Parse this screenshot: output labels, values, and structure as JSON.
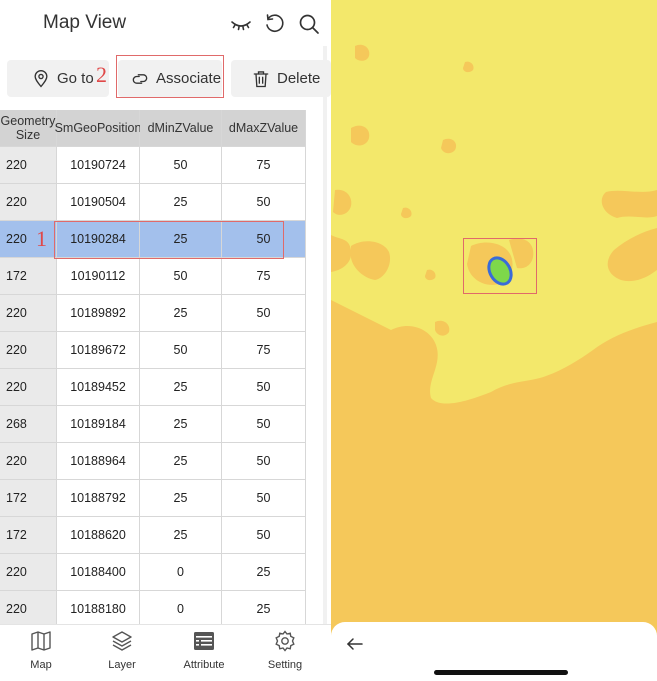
{
  "header": {
    "title": "Map View"
  },
  "toolbar": {
    "goto_label": "Go to",
    "associate_label": "Associate",
    "delete_label": "Delete"
  },
  "annotations": {
    "step1": "1",
    "step2": "2"
  },
  "table": {
    "headers": [
      "Geometry Size",
      "SmGeoPosition",
      "dMinZValue",
      "dMaxZValue"
    ],
    "rows": [
      [
        "220",
        "10190724",
        "50",
        "75"
      ],
      [
        "220",
        "10190504",
        "25",
        "50"
      ],
      [
        "220",
        "10190284",
        "25",
        "50"
      ],
      [
        "172",
        "10190112",
        "50",
        "75"
      ],
      [
        "220",
        "10189892",
        "25",
        "50"
      ],
      [
        "220",
        "10189672",
        "50",
        "75"
      ],
      [
        "220",
        "10189452",
        "25",
        "50"
      ],
      [
        "268",
        "10189184",
        "25",
        "50"
      ],
      [
        "220",
        "10188964",
        "25",
        "50"
      ],
      [
        "172",
        "10188792",
        "25",
        "50"
      ],
      [
        "172",
        "10188620",
        "25",
        "50"
      ],
      [
        "220",
        "10188400",
        "0",
        "25"
      ],
      [
        "220",
        "10188180",
        "0",
        "25"
      ]
    ],
    "selected_row": 2
  },
  "nav": {
    "items": [
      {
        "label": "Map",
        "icon": "map-icon"
      },
      {
        "label": "Layer",
        "icon": "layers-icon"
      },
      {
        "label": "Attribute",
        "icon": "attribute-table-icon"
      },
      {
        "label": "Setting",
        "icon": "gear-icon"
      }
    ]
  },
  "colors": {
    "map_background": "#f3e86b",
    "map_shapes": "#f5c85a",
    "selection_row": "#a3c0ec",
    "highlight_feature": "#7ed84a",
    "highlight_outline": "#3a6bd8",
    "annotation_red": "#e04848"
  }
}
